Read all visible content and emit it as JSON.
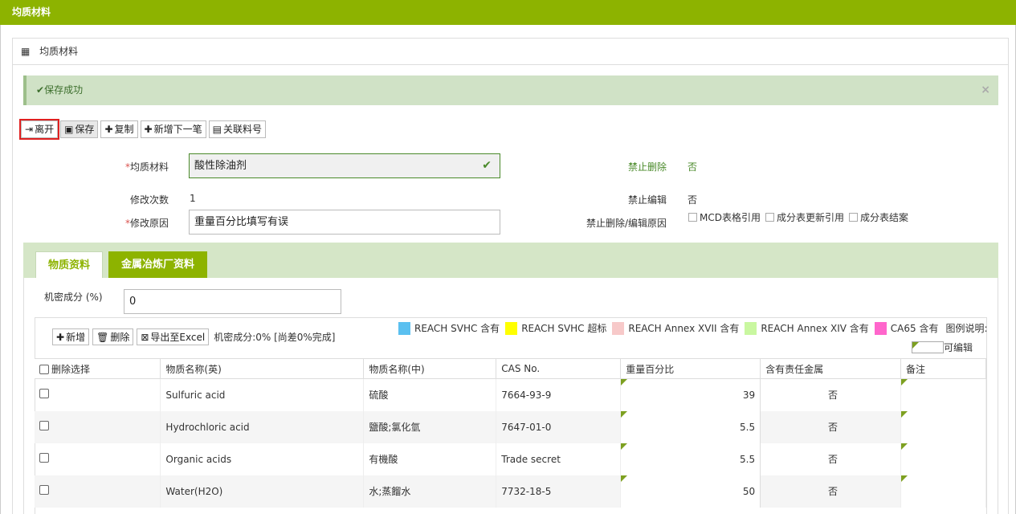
{
  "topbar": {
    "title": "均质材料"
  },
  "panel": {
    "title": "均质材料"
  },
  "alert": {
    "message": "保存成功",
    "close": "×"
  },
  "toolbar": {
    "leave": "离开",
    "save": "保存",
    "copy": "复制",
    "add_next": "新增下一笔",
    "link_part": "关联料号"
  },
  "form": {
    "material_label": "均质材料",
    "material_value": "酸性除油剂",
    "revisions_label": "修改次数",
    "revisions_value": "1",
    "reason_label": "修改原因",
    "reason_value": "重量百分比填写有误",
    "no_delete_label": "禁止删除",
    "no_delete_value": "否",
    "no_edit_label": "禁止编辑",
    "no_edit_value": "否",
    "no_reason_label": "禁止删除/编辑原因",
    "options": [
      "MCD表格引用",
      "成分表更新引用",
      "成分表结案"
    ]
  },
  "tabs": {
    "active": "物质资料",
    "inactive": "金属冶炼厂资料"
  },
  "confidential": {
    "label": "机密成分 (%)",
    "value": "0"
  },
  "grid_toolbar": {
    "add": "新增",
    "delete": "删除",
    "export": "导出至Excel",
    "info": "机密成分:0% [尚差0%完成]"
  },
  "legend": {
    "items": [
      {
        "label": "REACH SVHC 含有",
        "color": "#5bc0f0"
      },
      {
        "label": "REACH SVHC 超标",
        "color": "#ffff00"
      },
      {
        "label": "REACH Annex XVII 含有",
        "color": "#f7c9c9"
      },
      {
        "label": "REACH Annex XIV 含有",
        "color": "#c9f7a0"
      },
      {
        "label": "CA65 含有",
        "color": "#ff66cc"
      }
    ],
    "title": "图例说明:",
    "editable": "可编辑"
  },
  "table": {
    "headers": [
      "删除选择",
      "物质名称(英)",
      "物质名称(中)",
      "CAS No.",
      "重量百分比",
      "含有责任金属",
      "备注"
    ],
    "rows": [
      {
        "en": "Sulfuric acid",
        "zh": "硫酸",
        "cas": "7664-93-9",
        "weight": "39",
        "metal": "否",
        "note": ""
      },
      {
        "en": "Hydrochloric acid",
        "zh": "鹽酸;氯化氫",
        "cas": "7647-01-0",
        "weight": "5.5",
        "metal": "否",
        "note": ""
      },
      {
        "en": "Organic acids",
        "zh": "有機酸",
        "cas": "Trade secret",
        "weight": "5.5",
        "metal": "否",
        "note": ""
      },
      {
        "en": "Water(H2O)",
        "zh": "水;蒸餾水",
        "cas": "7732-18-5",
        "weight": "50",
        "metal": "否",
        "note": ""
      }
    ]
  }
}
